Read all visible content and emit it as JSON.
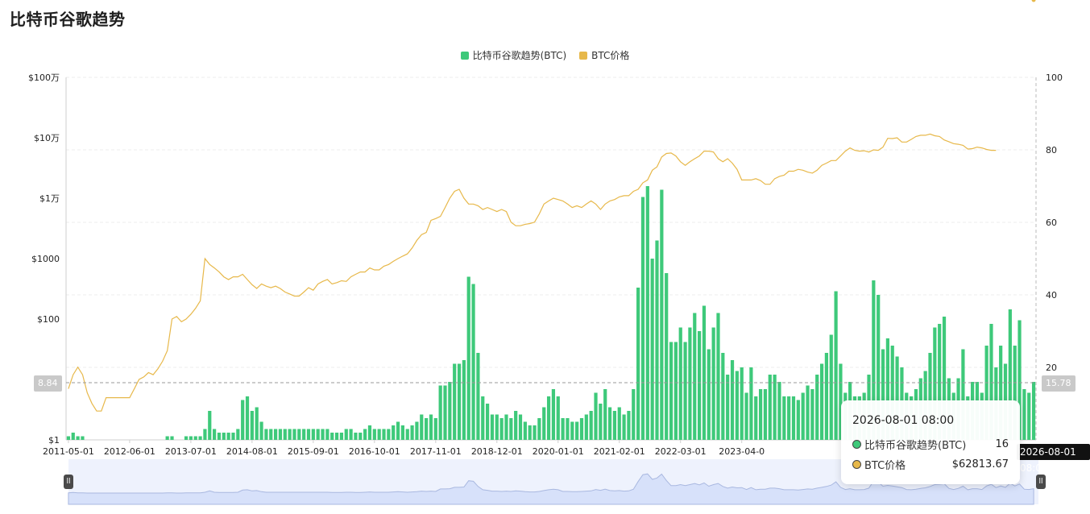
{
  "page": {
    "title": "比特币谷歌趋势"
  },
  "tooltip": {
    "date": "2026-08-01 08:00",
    "rows": [
      {
        "name": "比特币谷歌趋势(BTC)",
        "value": "16",
        "color": "#3ec97a"
      },
      {
        "name": "BTC价格",
        "value": "$62813.67",
        "color": "#e7b84a"
      }
    ]
  },
  "crosshair": {
    "x_label": "2026-08-01 08:00",
    "left_value": "8.84",
    "right_value": "15.78"
  },
  "chart_data": {
    "type": "bar",
    "legend": [
      {
        "name": "比特币谷歌趋势(BTC)",
        "color": "#3ec97a"
      },
      {
        "name": "BTC价格",
        "color": "#e7b84a"
      }
    ],
    "x_tick_labels": [
      "2011-05-01",
      "2012-06-01",
      "2013-07-01",
      "2014-08-01",
      "2015-09-01",
      "2016-10-01",
      "2017-11-01",
      "2018-12-01",
      "2020-01-01",
      "2021-02-01",
      "2022-03-01",
      "2023-04-0"
    ],
    "y_left": {
      "scale": "log",
      "ticks": [
        "$1",
        "$10",
        "$100",
        "$1000",
        "$1万",
        "$10万",
        "$100万"
      ],
      "tick_values": [
        1,
        10,
        100,
        1000,
        10000,
        100000,
        1000000
      ]
    },
    "y_right": {
      "ticks": [
        20,
        40,
        60,
        80,
        100
      ],
      "ylim": [
        0,
        100
      ]
    },
    "x_range": [
      "2011-05-01",
      "2026-08-01"
    ],
    "series": [
      {
        "name": "比特币谷歌趋势(BTC)",
        "type": "bar",
        "axis": "right",
        "x_start": "2011-05-01",
        "values": [
          1,
          2,
          1,
          1,
          0,
          0,
          0,
          0,
          0,
          0,
          0,
          0,
          0,
          0,
          0,
          0,
          0,
          0,
          0,
          0,
          0,
          1,
          1,
          0,
          0,
          1,
          1,
          1,
          1,
          3,
          8,
          3,
          2,
          2,
          2,
          2,
          3,
          11,
          12,
          8,
          9,
          5,
          3,
          3,
          3,
          3,
          3,
          3,
          3,
          3,
          3,
          3,
          3,
          3,
          3,
          3,
          2,
          2,
          2,
          3,
          3,
          2,
          2,
          3,
          4,
          3,
          3,
          3,
          3,
          4,
          5,
          4,
          3,
          4,
          5,
          7,
          6,
          7,
          6,
          15,
          15,
          16,
          21,
          21,
          22,
          45,
          43,
          24,
          12,
          10,
          7,
          7,
          6,
          7,
          6,
          8,
          7,
          5,
          4,
          4,
          6,
          9,
          12,
          14,
          12,
          6,
          6,
          5,
          5,
          6,
          7,
          8,
          13,
          10,
          14,
          9,
          8,
          9,
          7,
          8,
          14,
          42,
          67,
          70,
          50,
          55,
          69,
          46,
          27,
          27,
          31,
          27,
          31,
          35,
          30,
          37,
          25,
          31,
          35,
          24,
          18,
          22,
          19,
          20,
          13,
          20,
          12,
          14,
          14,
          18,
          18,
          16,
          12,
          12,
          12,
          11,
          13,
          15,
          14,
          18,
          21,
          24,
          29,
          41,
          21,
          13,
          16,
          12,
          12,
          13,
          18,
          44,
          40,
          25,
          28,
          26,
          23,
          20,
          13,
          12,
          14,
          17,
          19,
          24,
          31,
          32,
          34,
          17,
          13,
          17,
          25,
          12,
          16,
          16,
          13,
          26,
          32,
          20,
          26,
          21,
          36,
          26,
          33,
          14,
          13,
          16
        ]
      },
      {
        "name": "BTC价格",
        "type": "line",
        "axis": "left",
        "x_start": "2011-05-01",
        "values": [
          7,
          12,
          16,
          12,
          6,
          4,
          3,
          3,
          5,
          5,
          5,
          5,
          5,
          5,
          7,
          10,
          11,
          13,
          12,
          15,
          20,
          30,
          100,
          110,
          90,
          100,
          120,
          150,
          200,
          1000,
          800,
          700,
          600,
          500,
          450,
          500,
          500,
          550,
          450,
          370,
          320,
          380,
          350,
          330,
          350,
          320,
          280,
          260,
          240,
          240,
          280,
          330,
          300,
          380,
          420,
          450,
          380,
          400,
          430,
          420,
          500,
          550,
          600,
          600,
          700,
          650,
          650,
          750,
          800,
          900,
          1000,
          1100,
          1200,
          1500,
          2000,
          2500,
          2700,
          4300,
          4600,
          5000,
          7000,
          10000,
          13000,
          14000,
          10000,
          8000,
          8000,
          7500,
          6500,
          7000,
          6500,
          6000,
          6500,
          6000,
          4000,
          3500,
          3500,
          3700,
          3800,
          4000,
          5500,
          8000,
          9000,
          10000,
          9500,
          9000,
          8000,
          7000,
          7500,
          7000,
          8000,
          9000,
          8000,
          6500,
          8000,
          9000,
          9500,
          10500,
          11000,
          11000,
          13000,
          14000,
          18000,
          20000,
          29000,
          33000,
          48000,
          55000,
          56000,
          50000,
          40000,
          35000,
          40000,
          45000,
          50000,
          60000,
          60000,
          58000,
          45000,
          40000,
          45000,
          38000,
          30000,
          20000,
          20000,
          20000,
          21000,
          19500,
          17000,
          17000,
          21000,
          23000,
          24000,
          28000,
          28000,
          30000,
          29000,
          27000,
          26000,
          29000,
          35000,
          38000,
          42000,
          42000,
          50000,
          60000,
          68000,
          62000,
          60000,
          61000,
          58000,
          63000,
          62000,
          70000,
          98000,
          97000,
          100000,
          85000,
          85000,
          94000,
          105000,
          110000,
          110000,
          115000,
          108000,
          105000,
          92000,
          86000,
          80000,
          78000,
          75000,
          65000,
          66000,
          70000,
          68000,
          64000,
          62000,
          62000
        ]
      }
    ]
  }
}
